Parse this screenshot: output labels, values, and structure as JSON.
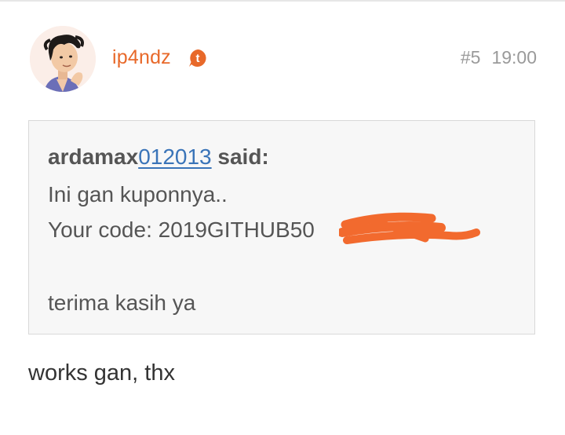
{
  "post": {
    "author": "ip4ndz",
    "badge_letter": "t",
    "post_number": "#5",
    "time": "19:00",
    "quote": {
      "attribution_prefix": "ardamax",
      "attribution_link": "012013",
      "attribution_suffix": " said:",
      "lines": [
        "Ini gan kuponnya..",
        "Your code: 2019GITHUB50",
        "terima kasih ya"
      ]
    },
    "body": "works gan, thx"
  },
  "colors": {
    "author": "#e8692a",
    "link": "#3a74b8",
    "meta": "#9a9a9a",
    "quote_bg": "#f7f7f7",
    "redaction": "#f26a2e"
  }
}
